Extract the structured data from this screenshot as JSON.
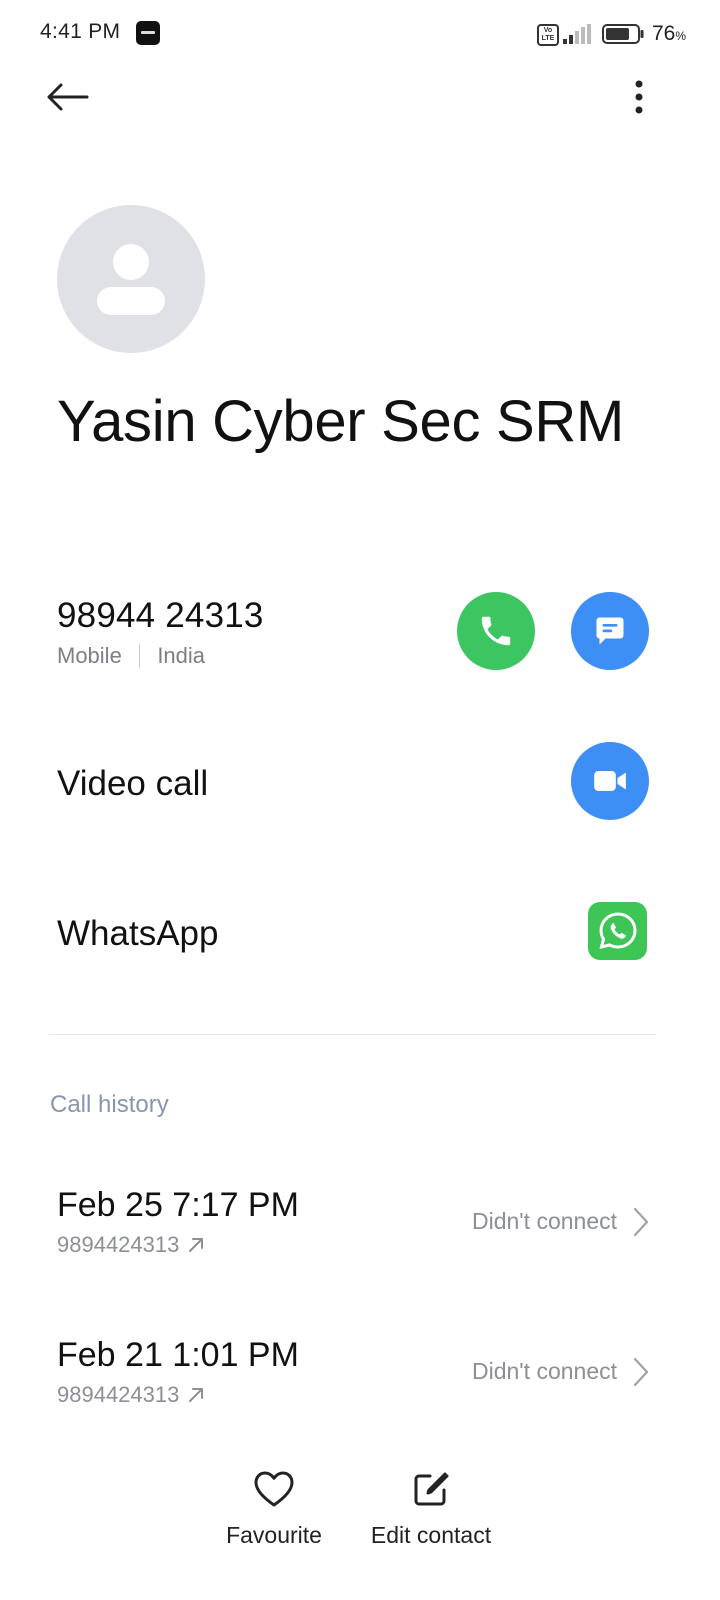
{
  "status_bar": {
    "time": "4:41 PM",
    "volte": "Vo LTE",
    "battery_percent": "76",
    "battery_unit": "%",
    "battery_level": 0.76
  },
  "contact": {
    "name": "Yasin Cyber Sec SRM",
    "phone": {
      "number": "98944 24313",
      "type": "Mobile",
      "region": "India"
    },
    "video_call_label": "Video call",
    "whatsapp_label": "WhatsApp"
  },
  "call_history": {
    "title": "Call history",
    "entries": [
      {
        "datetime": "Feb 25 7:17 PM",
        "number": "9894424313",
        "status": "Didn't connect",
        "direction_icon": "outgoing-arrow-icon"
      },
      {
        "datetime": "Feb 21 1:01 PM",
        "number": "9894424313",
        "status": "Didn't connect",
        "direction_icon": "outgoing-arrow-icon"
      }
    ]
  },
  "bottom_actions": {
    "favourite_label": "Favourite",
    "edit_label": "Edit contact"
  },
  "colors": {
    "call_green": "#3cc561",
    "action_blue": "#3d8ef5",
    "whatsapp_green": "#3dc556",
    "avatar_gray": "#dfe1e6",
    "section_title": "#8a95ad"
  }
}
